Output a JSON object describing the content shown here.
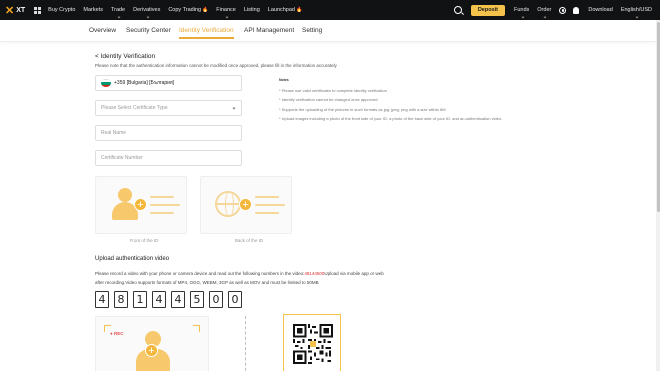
{
  "header": {
    "brand": "XT",
    "nav": [
      {
        "label": "Buy Crypto",
        "caret": false,
        "hot": false
      },
      {
        "label": "Markets",
        "caret": false,
        "hot": false
      },
      {
        "label": "Trade",
        "caret": true,
        "hot": false
      },
      {
        "label": "Derivatives",
        "caret": true,
        "hot": false
      },
      {
        "label": "Copy Trading",
        "caret": false,
        "hot": true
      },
      {
        "label": "Finance",
        "caret": true,
        "hot": false
      },
      {
        "label": "Listing",
        "caret": false,
        "hot": false
      },
      {
        "label": "Launchpad",
        "caret": false,
        "hot": true
      }
    ],
    "deposit_label": "Deposit",
    "funds_label": "Funds",
    "order_label": "Order",
    "download_label": "Download",
    "language_label": "English/USD"
  },
  "tabs": [
    {
      "label": "Overview",
      "active": false
    },
    {
      "label": "Security Center",
      "active": false
    },
    {
      "label": "Identity Verification",
      "active": true
    },
    {
      "label": "API Management",
      "active": false
    },
    {
      "label": "Setting",
      "active": false
    }
  ],
  "form": {
    "title": "< Identity Verification",
    "notice": "Please note that the authentication information cannot be modified once approved, please fill in the information accurately",
    "country_value": "+359 [Bulgaria] [България]",
    "certificate_type_placeholder": "Please Select Certificate Type",
    "real_name_placeholder": "Real Name",
    "certificate_number_placeholder": "Certificate Number",
    "front_caption": "Front of the ID",
    "back_caption": "Back of the ID"
  },
  "notes": {
    "title": "Notes",
    "items": [
      "* Please use valid certificates to complete identity verification",
      "* Identify verification cannot be changed once approved",
      "* Supports the uploading of the pictures in such formats as jpg, jpeg, png with a size within 8M",
      "* Upload images including a photo of the front side of your ID, a photo of the back side of your ID, and an authentication video."
    ]
  },
  "video": {
    "section_title": "Upload authentication video",
    "line1_prefix": "Please record a video with your phone or camera device and read out the following numbers in the video:",
    "code": "48144500",
    "line1_suffix": "Upload via mobile app or web",
    "line2": "after recording.Video supports formats of MP4, OGG, WEBM,  3GP as well as MOV and must be limited to 50MB",
    "digits": [
      "4",
      "8",
      "1",
      "4",
      "4",
      "5",
      "0",
      "0"
    ],
    "rec_label": "REC"
  },
  "colors": {
    "accent": "#e9a93b",
    "deposit": "#f5c34b",
    "illustration": "#f7c96c",
    "highlight": "#d63030",
    "flag": [
      "#ffffff",
      "#00966e",
      "#d62612"
    ]
  }
}
